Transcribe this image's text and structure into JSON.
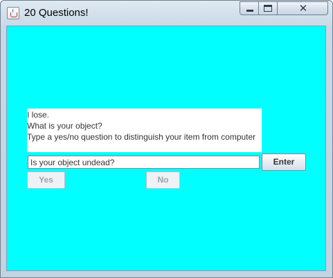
{
  "window": {
    "title": "20 Questions!",
    "app_icon": "java-cup-icon",
    "controls": {
      "minimize_icon": "minimize-icon",
      "maximize_icon": "maximize-icon",
      "close_icon": "close-icon",
      "close_glyph": "✕"
    }
  },
  "message_area": {
    "lines": [
      "I lose.",
      "What is your object?",
      "Type a yes/no question to distinguish your item from computer"
    ]
  },
  "question_input": {
    "value": "Is your object undead?"
  },
  "buttons": {
    "enter_label": "Enter",
    "yes_label": "Yes",
    "no_label": "No",
    "yes_enabled": false,
    "no_enabled": false
  },
  "colors": {
    "panel_background": "#00ffff",
    "message_background": "#ffffff",
    "disabled_text": "#9aa3ab"
  }
}
